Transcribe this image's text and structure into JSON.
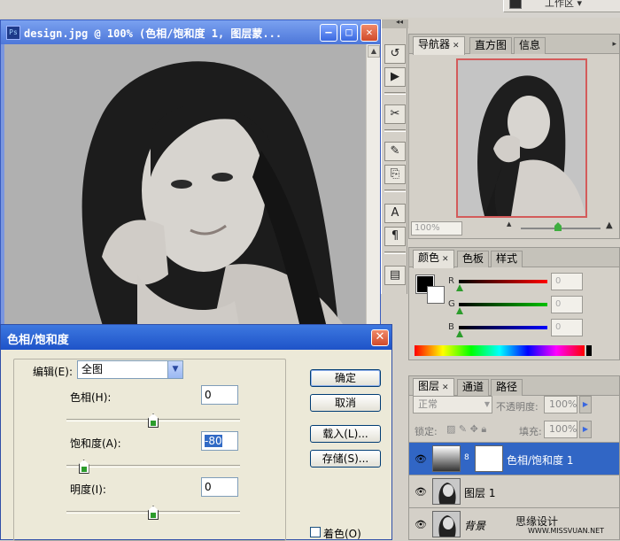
{
  "top": {
    "chip_label": "工作区 ▾"
  },
  "document": {
    "title": "design.jpg @ 100% (色相/饱和度 1, 图层蒙...",
    "ps_badge": "Ps",
    "minimize": "–",
    "maximize": "□",
    "close": "✕",
    "scroll_up": "▲"
  },
  "tools": {
    "collapse": "◂◂"
  },
  "navigator": {
    "tabs": [
      {
        "label": "导航器",
        "close": "✕"
      },
      {
        "label": "直方图"
      },
      {
        "label": "信息"
      }
    ],
    "menu": "▸",
    "zoom": "100%",
    "zoom_out": "▲",
    "zoom_in": "▲"
  },
  "color": {
    "tabs": [
      {
        "label": "颜色",
        "close": "✕"
      },
      {
        "label": "色板"
      },
      {
        "label": "样式"
      }
    ],
    "channels": [
      {
        "label": "R",
        "value": "0",
        "color": "#ff0000"
      },
      {
        "label": "G",
        "value": "0",
        "color": "#00c000"
      },
      {
        "label": "B",
        "value": "0",
        "color": "#0000ff"
      }
    ]
  },
  "layers": {
    "tabs": [
      {
        "label": "图层",
        "close": "✕"
      },
      {
        "label": "通道"
      },
      {
        "label": "路径"
      }
    ],
    "blend_mode": "正常",
    "opacity_label": "不透明度:",
    "opacity_value": "100%",
    "lock_label": "锁定:",
    "fill_label": "填充:",
    "fill_value": "100%",
    "rows": [
      {
        "name": "色相/饱和度 1",
        "selected": true
      },
      {
        "name": "图层 1",
        "selected": false
      },
      {
        "name": "背景",
        "selected": false
      }
    ]
  },
  "dialog": {
    "title": "色相/饱和度",
    "close": "✕",
    "edit_label": "编辑(E):",
    "edit_value": "全图",
    "hue_label": "色相(H):",
    "hue_value": "0",
    "saturation_label": "饱和度(A):",
    "saturation_value": "-80",
    "lightness_label": "明度(I):",
    "lightness_value": "0",
    "slider_levels": {
      "hue": 0,
      "saturation": -80,
      "lightness": 0
    },
    "ok": "确定",
    "cancel": "取消",
    "load": "载入(L)...",
    "save": "存储(S)...",
    "colorize": "着色(O)"
  },
  "watermark": {
    "line1": "思缘设计",
    "line2": "WWW.MISSVUAN.NET"
  }
}
